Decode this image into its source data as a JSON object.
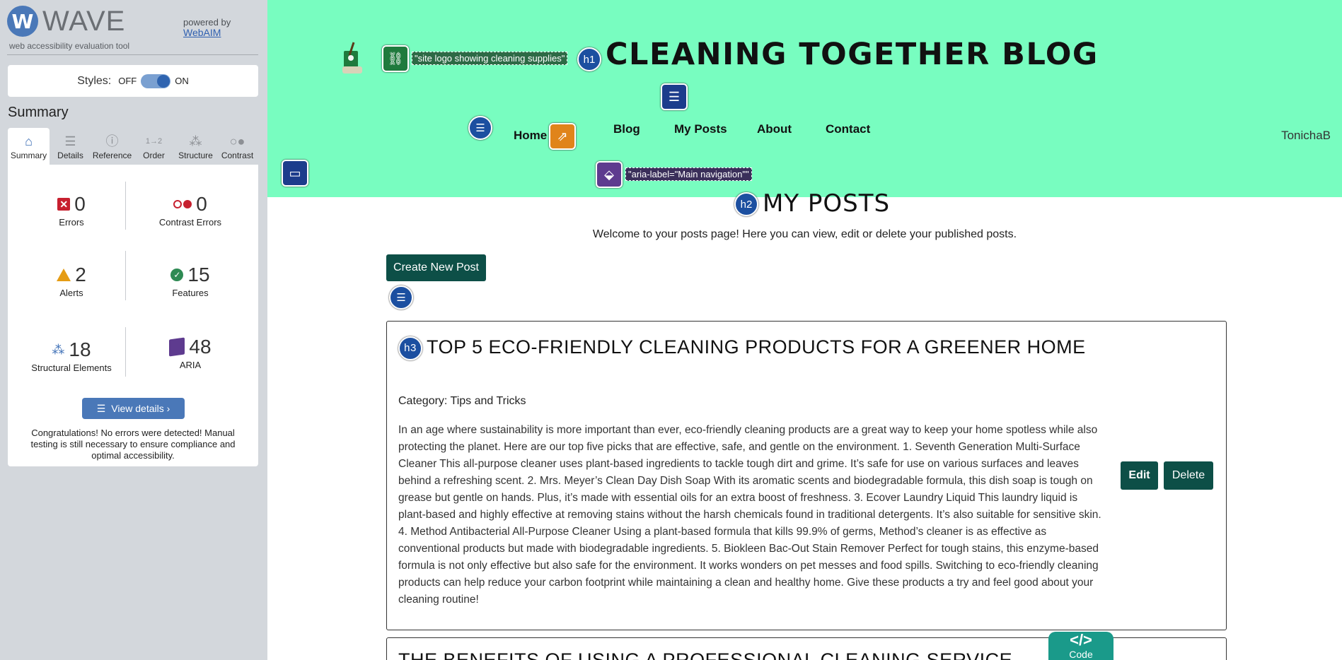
{
  "wave": {
    "logo_letter": "W",
    "logo_word": "WAVE",
    "tagline": "web accessibility evaluation tool",
    "powered_by": "powered by",
    "webaim_link": "WebAIM",
    "styles_label": "Styles:",
    "styles_off": "OFF",
    "styles_on": "ON",
    "summary_heading": "Summary",
    "tabs": [
      {
        "label": "Summary",
        "icon": "home-icon",
        "active": true
      },
      {
        "label": "Details",
        "icon": "list-icon"
      },
      {
        "label": "Reference",
        "icon": "info-icon"
      },
      {
        "label": "Order",
        "icon": "order-icon"
      },
      {
        "label": "Structure",
        "icon": "structure-icon"
      },
      {
        "label": "Contrast",
        "icon": "contrast-icon"
      }
    ],
    "stats": {
      "errors": {
        "value": "0",
        "label": "Errors",
        "color": "#c7202f"
      },
      "contrast_errors": {
        "value": "0",
        "label": "Contrast Errors"
      },
      "alerts": {
        "value": "2",
        "label": "Alerts",
        "color": "#e59c14"
      },
      "features": {
        "value": "15",
        "label": "Features",
        "color": "#2e8a53"
      },
      "structural": {
        "value": "18",
        "label": "Structural Elements",
        "color": "#3a6db5"
      },
      "aria": {
        "value": "48",
        "label": "ARIA",
        "color": "#5e3b8f"
      }
    },
    "view_details": "View details ›",
    "congrats": "Congratulations! No errors were detected! Manual testing is still necessary to ensure compliance and optimal accessibility."
  },
  "page": {
    "header_bg": "#78fdc0",
    "site_title": "CLEANING TOGETHER BLOG",
    "logo_alt_label": "\"site logo showing cleaning supplies\"",
    "aria_label_text": "\"aria-label=\"Main navigation\"\"",
    "h1_badge": "h1",
    "h2_badge": "h2",
    "h3_badge": "h3",
    "nav": [
      "Home",
      "Blog",
      "My Posts",
      "About",
      "Contact"
    ],
    "username": "TonichaB",
    "heading": "MY POSTS",
    "welcome": "Welcome to your posts page! Here you can view, edit or delete your published posts.",
    "create_button": "Create New Post",
    "accent": "#0d4f47",
    "posts": [
      {
        "title": "TOP 5 ECO-FRIENDLY CLEANING PRODUCTS FOR A GREENER HOME",
        "category": "Category: Tips and Tricks",
        "body": "In an age where sustainability is more important than ever, eco-friendly cleaning products are a great way to keep your home spotless while also protecting the planet. Here are our top five picks that are effective, safe, and gentle on the environment. 1. Seventh Generation Multi-Surface Cleaner This all-purpose cleaner uses plant-based ingredients to tackle tough dirt and grime. It’s safe for use on various surfaces and leaves behind a refreshing scent. 2. Mrs. Meyer’s Clean Day Dish Soap With its aromatic scents and biodegradable formula, this dish soap is tough on grease but gentle on hands. Plus, it’s made with essential oils for an extra boost of freshness. 3. Ecover Laundry Liquid This laundry liquid is plant-based and highly effective at removing stains without the harsh chemicals found in traditional detergents. It’s also suitable for sensitive skin. 4. Method Antibacterial All-Purpose Cleaner Using a plant-based formula that kills 99.9% of germs, Method’s cleaner is as effective as conventional products but made with biodegradable ingredients. 5. Biokleen Bac-Out Stain Remover Perfect for tough stains, this enzyme-based formula is not only effective but also safe for the environment. It works wonders on pet messes and food spills. Switching to eco-friendly cleaning products can help reduce your carbon footprint while maintaining a clean and healthy home. Give these products a try and feel good about your cleaning routine!",
        "edit": "Edit",
        "delete": "Delete"
      },
      {
        "title": "THE BENEFITS OF USING A PROFESSIONAL CLEANING SERVICE"
      }
    ],
    "code_tab_symbol": "</>",
    "code_tab_label": "Code"
  }
}
